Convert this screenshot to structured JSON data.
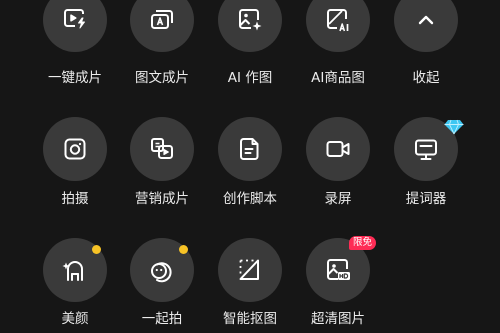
{
  "colors": {
    "background": "#161616",
    "tile": "#3a3a3a",
    "icon": "#ffffff",
    "dot": "#f7c326",
    "badge": "#fe2c55",
    "gem": "#3ec7f2"
  },
  "rows": [
    [
      {
        "label": "一键成片",
        "icon": "video-lightning-icon"
      },
      {
        "label": "图文成片",
        "icon": "image-text-icon"
      },
      {
        "label": "AI 作图",
        "icon": "ai-image-icon"
      },
      {
        "label": "AI商品图",
        "icon": "ai-product-image-icon"
      },
      {
        "label": "收起",
        "icon": "chevron-up-icon"
      }
    ],
    [
      {
        "label": "拍摄",
        "icon": "camera-icon"
      },
      {
        "label": "营销成片",
        "icon": "marketing-video-icon"
      },
      {
        "label": "创作脚本",
        "icon": "script-document-icon"
      },
      {
        "label": "录屏",
        "icon": "screen-record-icon"
      },
      {
        "label": "提词器",
        "icon": "teleprompter-icon"
      }
    ],
    [
      {
        "label": "美颜",
        "icon": "beauty-face-icon"
      },
      {
        "label": "一起拍",
        "icon": "shoot-together-icon"
      },
      {
        "label": "智能抠图",
        "icon": "smart-cutout-icon"
      },
      {
        "label": "超清图片",
        "icon": "hd-image-icon"
      }
    ]
  ],
  "badges": {
    "hd_image": "限免"
  }
}
